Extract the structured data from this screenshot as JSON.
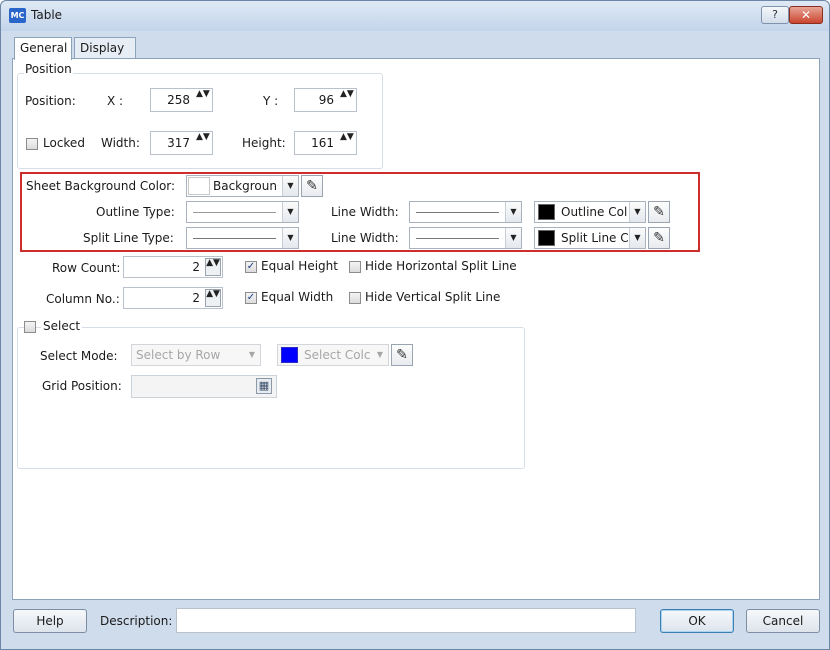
{
  "window": {
    "title": "Table",
    "app_badge": "MC",
    "help_glyph": "?",
    "close_glyph": "✕"
  },
  "tabs": [
    {
      "label": "General",
      "active": true
    },
    {
      "label": "Display",
      "active": false
    }
  ],
  "position": {
    "group_title": "Position",
    "position_label": "Position:",
    "x_label": "X :",
    "x_value": "258",
    "y_label": "Y :",
    "y_value": "96",
    "locked_label": "Locked",
    "locked_checked": false,
    "width_label": "Width:",
    "width_value": "317",
    "height_label": "Height:",
    "height_value": "161"
  },
  "appearance": {
    "sheet_bg_label": "Sheet Background Color:",
    "sheet_bg_value": "Backgroun",
    "sheet_bg_color": "#ffffff",
    "outline_type_label": "Outline Type:",
    "outline_line_width_label": "Line Width:",
    "outline_color_value": "Outline Col",
    "outline_color": "#000000",
    "split_line_type_label": "Split Line Type:",
    "split_line_width_label": "Line Width:",
    "split_color_value": "Split Line C",
    "split_color": "#000000",
    "highlight_color": "#cf2c2c"
  },
  "grid": {
    "row_count_label": "Row Count:",
    "row_count_value": "2",
    "equal_height_label": "Equal Height",
    "equal_height_checked": true,
    "hide_horizontal_label": "Hide Horizontal Split Line",
    "hide_horizontal_checked": false,
    "column_no_label": "Column No.:",
    "column_no_value": "2",
    "equal_width_label": "Equal Width",
    "equal_width_checked": true,
    "hide_vertical_label": "Hide Vertical Split Line",
    "hide_vertical_checked": false
  },
  "select": {
    "group_label": "Select",
    "checked": false,
    "mode_label": "Select Mode:",
    "mode_value": "Select by Row",
    "color_value": "Select Colc",
    "color": "#0000ff",
    "grid_position_label": "Grid Position:",
    "grid_position_value": "",
    "grid_icon_glyph": "▦"
  },
  "footer": {
    "help_label": "Help",
    "description_label": "Description:",
    "description_value": "",
    "ok_label": "OK",
    "cancel_label": "Cancel"
  },
  "glyphs": {
    "check": "✓",
    "spin": "▲▼",
    "dropdown": "▼",
    "picker": "✎"
  }
}
